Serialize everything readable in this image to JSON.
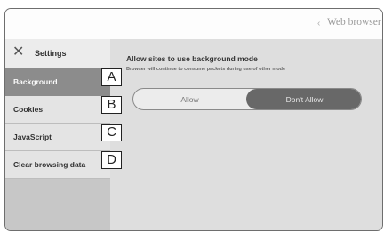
{
  "header": {
    "back_glyph": "‹",
    "title": "Web browser"
  },
  "sidebar": {
    "close_glyph": "✕",
    "title": "Settings",
    "items": [
      {
        "label": "Background",
        "active": true
      },
      {
        "label": "Cookies",
        "active": false
      },
      {
        "label": "JavaScript",
        "active": false
      },
      {
        "label": "Clear browsing data",
        "active": false
      }
    ]
  },
  "callouts": [
    "A",
    "B",
    "C",
    "D"
  ],
  "content": {
    "title": "Allow sites to use background mode",
    "description": "Browser will continue to consume packets during use of other mode",
    "toggle": {
      "options": [
        "Allow",
        "Don't Allow"
      ],
      "selected": "Don't Allow"
    }
  },
  "colors": {
    "active_menu": "#8c8c8c",
    "selected_segment": "#686868"
  }
}
